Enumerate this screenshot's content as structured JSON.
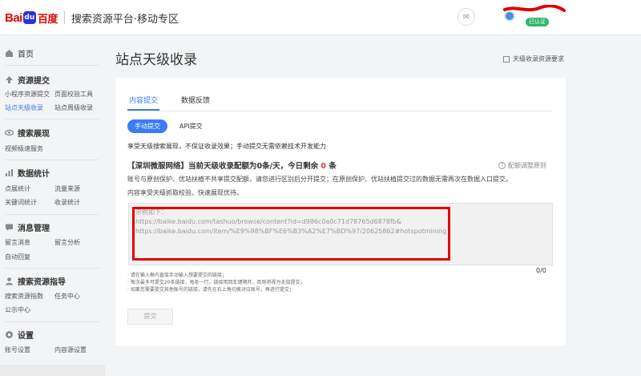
{
  "header": {
    "logo_bai": "Bai",
    "logo_paw": "du",
    "logo_cn": "百度",
    "title": "搜索资源平台·移动专区",
    "mail_icon": "mail-icon",
    "user_badge": "已认证"
  },
  "sidebar": {
    "home": "首页",
    "sections": [
      {
        "title": "资源提交",
        "icon": "upload-icon",
        "links": [
          "小程序资源提交",
          "页面校验工具",
          "站点天级收录",
          "站点周级收录"
        ]
      },
      {
        "title": "搜索展现",
        "icon": "eye-icon",
        "links": [
          "视频极速服务"
        ]
      },
      {
        "title": "数据统计",
        "icon": "bar-chart-icon",
        "links": [
          "点展统计",
          "流量来源",
          "关键词统计",
          "收录统计"
        ]
      },
      {
        "title": "消息管理",
        "icon": "message-icon",
        "links": [
          "留言消息",
          "留言分析",
          "自动回复"
        ]
      },
      {
        "title": "搜索资源指导",
        "icon": "person-icon",
        "links": [
          "搜索资源指数",
          "任务中心",
          "公示中心"
        ]
      },
      {
        "title": "设置",
        "icon": "gear-icon",
        "links": [
          "账号设置",
          "内容源设置"
        ]
      }
    ],
    "active_link": "站点天级收录",
    "colors": {
      "active": "#3a7cf5"
    }
  },
  "main": {
    "page_title": "站点天级收录",
    "requirement_link": "天级收录资源要求",
    "tabs": [
      "内容提交",
      "数据反馈"
    ],
    "active_tab": "内容提交",
    "submit_modes": [
      "手动提交",
      "API提交"
    ],
    "description": "享受天级搜索展现，不保证收录效果；手动提交无需依赖技术开发能力",
    "quota": {
      "prefix": "【深圳微服网络】当前天级收录配额为0条/天，今日剩余 ",
      "remaining": "0",
      "suffix": " 条"
    },
    "rule_link": "配额调整原则",
    "note1": "账号与原创保护、优站扶植不共享提交配额，请您进行区别后分开提交；在原创保护、优站扶植提交过的数据无需再次在数据入口提交。",
    "note2": "内容享受天级抓取校验、快速展现优待。",
    "textarea": {
      "example_label": "示例如下：",
      "example_line1": "https://baike.baidu.com/tashuo/browse/content?id=d986c0a0c71d78765d6878fb&",
      "example_line2": "https://baike.baidu.com/item/%E9%98%BF%E6%B3%A2%E7%BD%97/20625862#hotspotmining"
    },
    "counter": "0/0",
    "tips": [
      "· 请在输入框内直接手动输入想要提交的链接；",
      "· 每次最多可提交20条链接，每条一行，链接用回车键隔开，否则将视为无效提交；",
      "· 如果您需要提交其他账号的链接，请先在右上角切换对应账号，再进行提交；"
    ],
    "submit_button": "提交"
  }
}
